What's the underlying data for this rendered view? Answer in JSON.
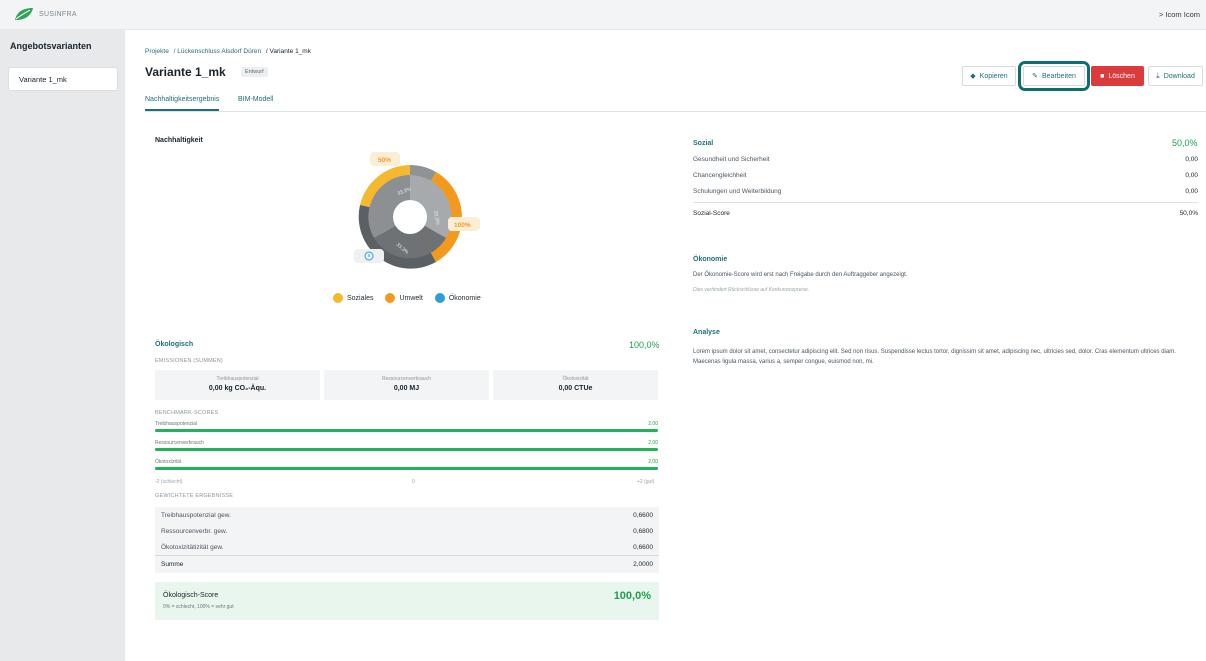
{
  "app": {
    "logo_text": "SUSINFRA",
    "user": "> Icom Icom"
  },
  "sidebar": {
    "title": "Angebotsvarianten",
    "items": [
      {
        "label": "Variante 1_mk"
      }
    ]
  },
  "breadcrumb": [
    "Projekte",
    "/ Lückenschluss Alsdorf Düren",
    "/ Variante 1_mk"
  ],
  "page": {
    "title": "Variante 1_mk",
    "badge": "Entwurf"
  },
  "actions": {
    "copy": "Kopieren",
    "edit": "Bearbeiten",
    "delete": "Löschen",
    "download": "Download"
  },
  "tabs": [
    "Nachhaltigkeitsergebnis",
    "BIM-Modell"
  ],
  "nachhaltigkeit": {
    "title": "Nachhaltigkeit",
    "callouts": [
      "50%",
      "100%"
    ],
    "legend": [
      "Soziales",
      "Umwelt",
      "Ökonomie"
    ],
    "colors": {
      "soziales": "#f5b82e",
      "umwelt": "#f39a1e",
      "oekonomie": "#2c9fdb"
    }
  },
  "chart_data": {
    "type": "pie",
    "title": "Nachhaltigkeit",
    "inner_labels": [
      "33,3%",
      "33,3%",
      "33,3%"
    ],
    "outer": [
      {
        "name": "Soziales",
        "value": 50
      },
      {
        "name": "Umwelt",
        "value": 100
      },
      {
        "name": "Ökonomie",
        "value": 0
      }
    ],
    "legend": [
      "Soziales",
      "Umwelt",
      "Ökonomie"
    ]
  },
  "oekologisch": {
    "title": "Ökologisch",
    "score": "100,0%",
    "emissionen_label": "EMISSIONEN (SUMMEN)",
    "emissionen": [
      {
        "label": "Treibhauspotenzial",
        "value": "0,00 kg CO₂-Äqu."
      },
      {
        "label": "Ressourcenverbrauch",
        "value": "0,00 MJ"
      },
      {
        "label": "Ökotoxizität",
        "value": "0,00 CTUe"
      }
    ],
    "benchmark_label": "BENCHMARK-SCORES",
    "benchmarks": [
      {
        "label": "Treibhauspotenzial",
        "value": "2,00",
        "fraction": 1.0
      },
      {
        "label": "Ressourcenverbrauch",
        "value": "2,00",
        "fraction": 1.0
      },
      {
        "label": "Ökotoxizität",
        "value": "2,00",
        "fraction": 1.0
      }
    ],
    "scale": {
      "min": "-2 (schlecht)",
      "mid": "0",
      "max": "+2 (gut)"
    },
    "gewichtet_label": "GEWICHTETE ERGEBNISSE",
    "gewichtet": [
      {
        "label": "Treibhauspotenzial gew.",
        "value": "0,6600"
      },
      {
        "label": "Ressourcenverbr. gew.",
        "value": "0,6800"
      },
      {
        "label": "Ökotoxizitätizität gew.",
        "value": "0,6600"
      }
    ],
    "summe": {
      "label": "Summe",
      "value": "2,0000"
    },
    "final": {
      "title": "Ökologisch-Score",
      "sub": "0% = schlecht, 100% = sehr gut",
      "value": "100,0%"
    }
  },
  "sozial": {
    "title": "Sozial",
    "score": "50,0%",
    "rows": [
      {
        "label": "Gesundheit und Sicherheit",
        "value": "0,00"
      },
      {
        "label": "Chancengleichheit",
        "value": "0,00"
      },
      {
        "label": "Schulungen und Weiterbildung",
        "value": "0,00"
      }
    ],
    "score_row": {
      "label": "Sozial-Score",
      "value": "50,0%"
    }
  },
  "oekonomie": {
    "title": "Ökonomie",
    "text": "Der Ökonomie-Score wird erst nach Freigabe durch den Auftraggeber angezeigt.",
    "note": "Dies verhindert Rückschlüsse auf Konkurrenzpreise."
  },
  "analyse": {
    "title": "Analyse",
    "text": "Lorem ipsum dolor sit amet, consectetur adipiscing elit. Sed non risus. Suspendisse lectus tortor, dignissim sit amet, adipiscing nec, ultricies sed, dolor. Cras elementum ultrices diam. Maecenas ligula massa, varius a, semper congue, euismod non, mi."
  }
}
